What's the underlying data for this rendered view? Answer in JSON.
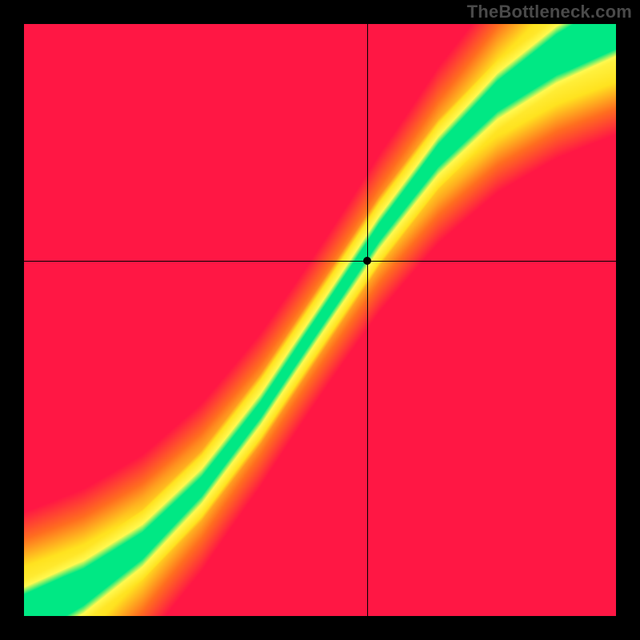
{
  "attribution": "TheBottleneck.com",
  "chart_data": {
    "type": "heatmap",
    "title": "",
    "xlabel": "",
    "ylabel": "",
    "xlim": [
      0,
      1
    ],
    "ylim": [
      0,
      1
    ],
    "crosshair": {
      "x": 0.58,
      "y": 0.6
    },
    "marker": {
      "x": 0.58,
      "y": 0.6
    },
    "colormap": {
      "description": "Red → Orange → Yellow → Green heatmap. Green band traces an S-shaped optimal curve from lower-left to upper-right; deviation toward lower-right or upper-left transitions through yellow/orange into red.",
      "stops": [
        {
          "t": 0.0,
          "color": "#ff1744"
        },
        {
          "t": 0.25,
          "color": "#ff6d1f"
        },
        {
          "t": 0.5,
          "color": "#ffe21f"
        },
        {
          "t": 0.8,
          "color": "#fff94f"
        },
        {
          "t": 1.0,
          "color": "#00e884"
        }
      ]
    },
    "optimal_curve": [
      {
        "x": 0.0,
        "y": 0.0
      },
      {
        "x": 0.1,
        "y": 0.05
      },
      {
        "x": 0.2,
        "y": 0.12
      },
      {
        "x": 0.3,
        "y": 0.22
      },
      {
        "x": 0.4,
        "y": 0.35
      },
      {
        "x": 0.5,
        "y": 0.5
      },
      {
        "x": 0.6,
        "y": 0.65
      },
      {
        "x": 0.7,
        "y": 0.78
      },
      {
        "x": 0.8,
        "y": 0.88
      },
      {
        "x": 0.9,
        "y": 0.95
      },
      {
        "x": 1.0,
        "y": 1.0
      }
    ],
    "band_half_width": 0.06,
    "grid": false,
    "legend": null
  }
}
